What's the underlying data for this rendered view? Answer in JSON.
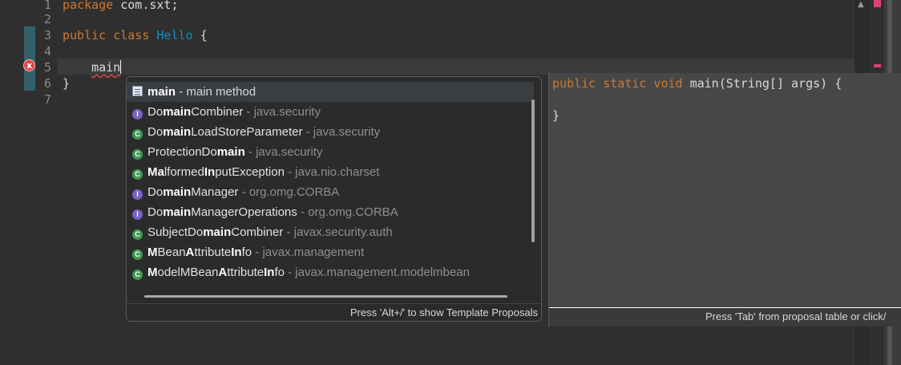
{
  "editor": {
    "line_numbers": [
      "1",
      "2",
      "3",
      "4",
      "5",
      "6",
      "7"
    ],
    "lines": [
      {
        "kw": "package",
        "rest": " com.sxt;"
      },
      {
        "text": ""
      },
      {
        "kw": "public class",
        "cls": "Hello",
        "rest": " {"
      },
      {
        "text": ""
      },
      {
        "indent": "    ",
        "err": "main"
      },
      {
        "text": "}"
      },
      {
        "text": ""
      }
    ],
    "error_icon": "error-icon",
    "error_glyph": "x"
  },
  "proposals": {
    "items": [
      {
        "icon": "method-icon",
        "kind_glyph": "",
        "name_bold": "main",
        "name_rest": "",
        "sep": " - ",
        "detail": "main method",
        "selected": true
      },
      {
        "icon": "interface-icon",
        "kind_glyph": "I",
        "pre": "Do",
        "bold": "main",
        "post": "Combiner",
        "pkg": "java.security"
      },
      {
        "icon": "class-icon",
        "kind_glyph": "C",
        "pre": "Do",
        "bold": "main",
        "post": "LoadStoreParameter",
        "pkg": "java.security"
      },
      {
        "icon": "class-icon",
        "kind_glyph": "C",
        "pre": "ProtectionDo",
        "bold": "main",
        "post": "",
        "pkg": "java.security"
      },
      {
        "icon": "class-icon",
        "kind_glyph": "C",
        "pre": "",
        "bold": "Ma",
        "post": "lformed",
        "bold2": "In",
        "post2": "putException",
        "pkg": "java.nio.charset"
      },
      {
        "icon": "interface-icon",
        "kind_glyph": "I",
        "pre": "Do",
        "bold": "main",
        "post": "Manager",
        "pkg": "org.omg.CORBA"
      },
      {
        "icon": "interface-icon",
        "kind_glyph": "I",
        "pre": "Do",
        "bold": "main",
        "post": "ManagerOperations",
        "pkg": "org.omg.CORBA"
      },
      {
        "icon": "class-icon",
        "kind_glyph": "C",
        "pre": "SubjectDo",
        "bold": "main",
        "post": "Combiner",
        "pkg": "javax.security.auth"
      },
      {
        "icon": "class-icon",
        "kind_glyph": "C",
        "pre": "",
        "bold": "M",
        "post": "Bean",
        "bold2": "A",
        "post2": "ttribute",
        "bold3": "In",
        "post3": "fo",
        "pkg": "javax.management"
      },
      {
        "icon": "class-icon",
        "kind_glyph": "C",
        "pre": "",
        "bold": "M",
        "post": "odelMBean",
        "bold2": "A",
        "post2": "ttribute",
        "bold3": "In",
        "post3": "fo",
        "pkg": "javax.management.modelmbean"
      }
    ],
    "pkg_sep": " - ",
    "footer": "Press 'Alt+/' to show Template Proposals"
  },
  "info": {
    "signature_kw": "public static void",
    "signature_rest": " main(String[] args) {",
    "closing": "}",
    "footer": "Press 'Tab' from proposal table or click/"
  }
}
